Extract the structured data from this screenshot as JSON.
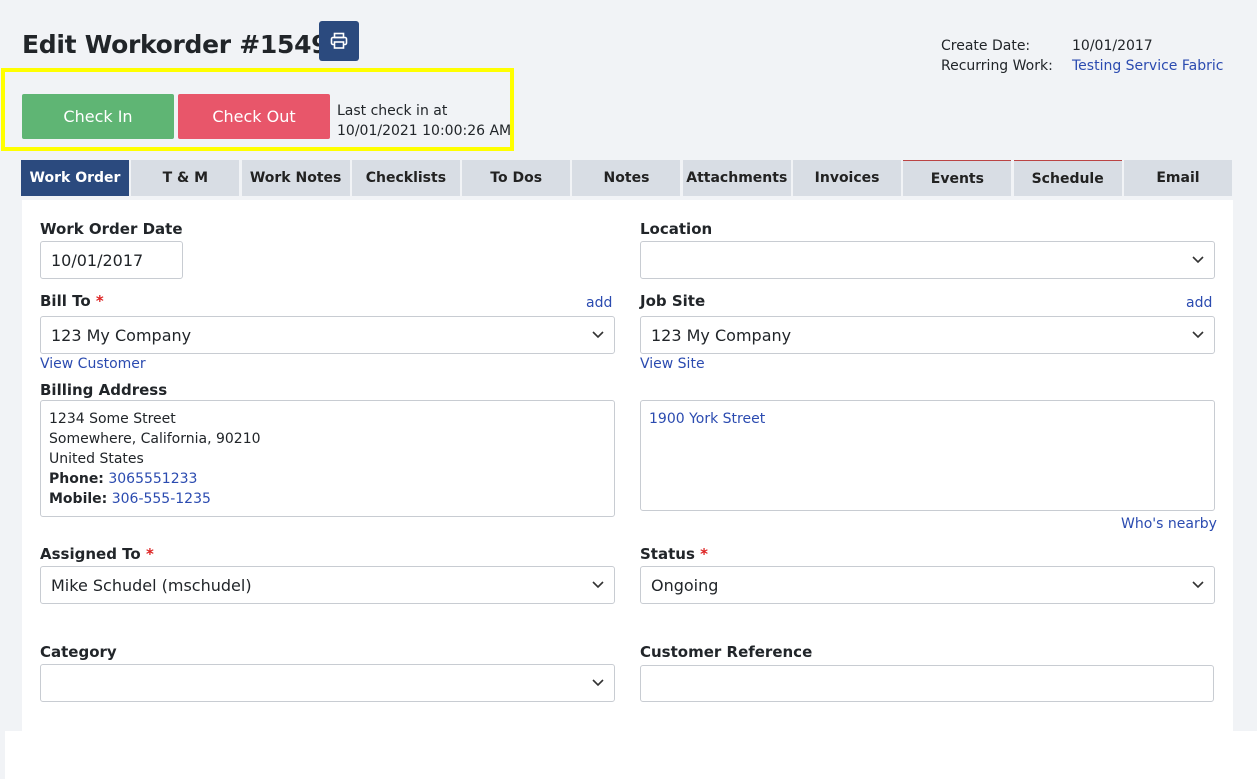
{
  "header": {
    "title": "Edit Workorder #1549",
    "print_icon": "printer-icon"
  },
  "meta": {
    "create_date_label": "Create Date:",
    "create_date_value": "10/01/2017",
    "recurring_label": "Recurring Work:",
    "recurring_value": "Testing Service Fabric"
  },
  "checkin": {
    "check_in_label": "Check In",
    "check_out_label": "Check Out",
    "last_line1": "Last check in at",
    "last_line2": "10/01/2021 10:00:26 AM"
  },
  "tabs": [
    "Work Order",
    "T & M",
    "Work Notes",
    "Checklists",
    "To Dos",
    "Notes",
    "Attachments",
    "Invoices",
    "Events",
    "Schedule",
    "Email"
  ],
  "form": {
    "wo_date_label": "Work Order Date",
    "wo_date_value": "10/01/2017",
    "location_label": "Location",
    "location_value": "",
    "bill_to_label": "Bill To",
    "required_mark": "*",
    "add_label": "add",
    "bill_to_value": "123 My Company",
    "view_customer": "View Customer",
    "job_site_label": "Job Site",
    "job_site_value": "123 My Company",
    "view_site": "View Site",
    "billing_address_label": "Billing Address",
    "billing": {
      "line1": "1234 Some Street",
      "line2": "Somewhere, California, 90210",
      "line3": "United States",
      "phone_label": "Phone:",
      "phone": "3065551233",
      "mobile_label": "Mobile:",
      "mobile": "306-555-1235"
    },
    "site_address": "1900 York Street",
    "whos_nearby": "Who's nearby",
    "assigned_label": "Assigned To",
    "assigned_value": "Mike Schudel (mschudel)",
    "status_label": "Status",
    "status_value": "Ongoing",
    "category_label": "Category",
    "category_value": "",
    "cust_ref_label": "Customer Reference",
    "cust_ref_value": ""
  },
  "colors": {
    "primary": "#2b4a7e",
    "check_in": "#5fb574",
    "check_out": "#e8566a",
    "highlight": "#ffff00",
    "link": "#2b4bb0"
  }
}
